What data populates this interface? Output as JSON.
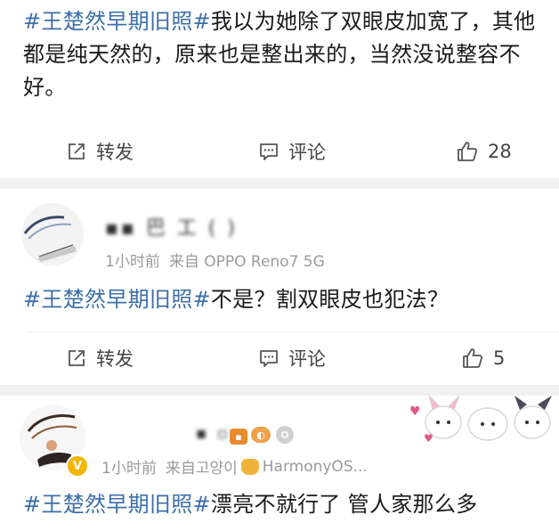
{
  "posts": [
    {
      "hashtag": "#王楚然早期旧照#",
      "line1_rest": "我以为她除了双眼皮加宽了，其他",
      "line2": "都是纯天然的，原来也是整出来的，当然没说整容不",
      "line3": "好。",
      "actions": {
        "repost": "转发",
        "comment": "评论",
        "like_count": "28"
      }
    },
    {
      "time": "1小时前",
      "source": "来自 OPPO Reno7 5G",
      "hashtag": "#王楚然早期旧照#",
      "text": "不是？割双眼皮也犯法？",
      "actions": {
        "repost": "转发",
        "comment": "评论",
        "like_count": "5"
      }
    },
    {
      "time": "1小时前",
      "source_prefix": "来自고양이",
      "source_suffix": "HarmonyOS...",
      "hashtag": "#王楚然早期旧照#",
      "text": "漂亮不就行了 管人家那么多"
    }
  ],
  "colors": {
    "hashtag": "#3d6fa8",
    "text": "#1a1a1a",
    "meta": "#9a9a9a",
    "action": "#444444",
    "separator": "#f1f1f1"
  },
  "icons": {
    "repost": "repost-icon",
    "comment": "comment-icon",
    "like": "thumbs-up-icon"
  }
}
